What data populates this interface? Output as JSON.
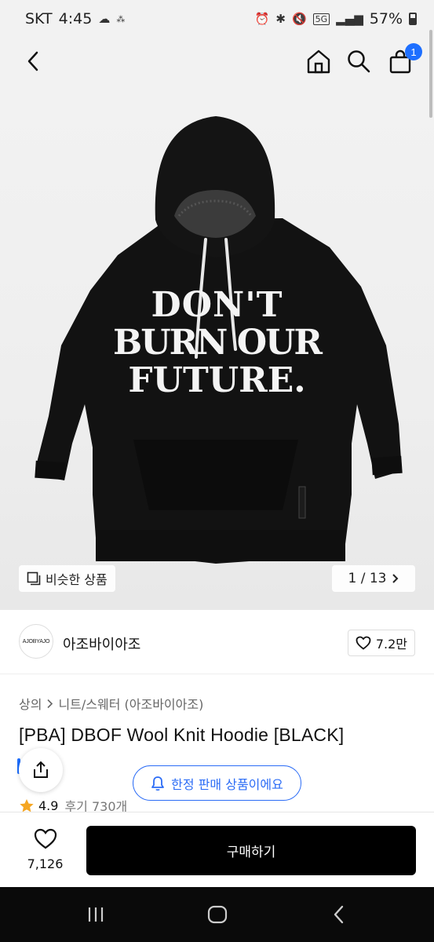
{
  "status_bar": {
    "carrier": "SKT",
    "time": "4:45",
    "network": "5G",
    "battery_percent": "57%"
  },
  "header": {
    "icons": [
      "back-icon",
      "home-icon",
      "search-icon",
      "cart-icon"
    ],
    "cart_badge": "1"
  },
  "product_image": {
    "similar_label": "비슷한 상품",
    "page_counter": "1 / 13",
    "print_lines": [
      "DON'T",
      "BURN OUR",
      "FUTURE."
    ],
    "colors": {
      "background": "#f0f0f0",
      "garment": "#121212",
      "print": "#f4f4f4"
    }
  },
  "brand": {
    "logo_text": "AJOBYAJO",
    "name": "아조바이아조",
    "likes": "7.2만"
  },
  "breadcrumb": {
    "category": "상의",
    "subcategory": "니트/스웨터 (아조바이아조)"
  },
  "product": {
    "title": "[PBA] DBOF Wool Knit Hoodie [BLACK]",
    "limited_notice": "한정 판매 상품이에요",
    "rating": "4.9",
    "review_count": "후기 730개"
  },
  "bottom_bar": {
    "wish_count": "7,126",
    "buy_label": "구매하기"
  },
  "colors": {
    "accent_blue": "#2b6cf6",
    "badge_blue": "#1e6fff",
    "star": "#f5a623",
    "buy_button": "#000000"
  }
}
